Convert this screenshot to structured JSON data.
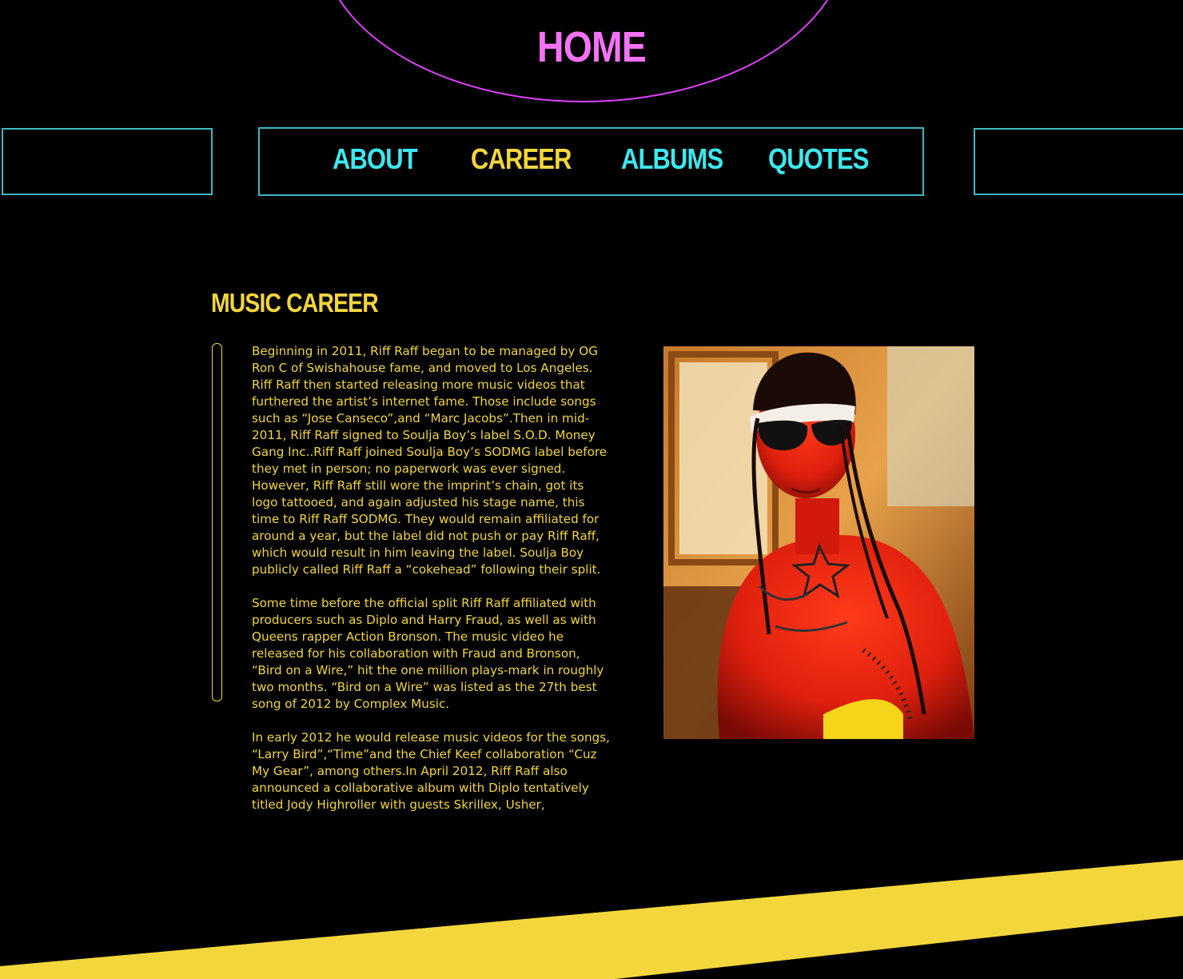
{
  "header": {
    "home_label": "HOME"
  },
  "nav": {
    "items": [
      {
        "label": "ABOUT",
        "color": "#3de8ef"
      },
      {
        "label": "CAREER",
        "color": "#f3d63b"
      },
      {
        "label": "ALBUMS",
        "color": "#3de8ef"
      },
      {
        "label": "QUOTES",
        "color": "#3de8ef"
      }
    ]
  },
  "main": {
    "title": "MUSIC CAREER",
    "paragraphs": [
      "Beginning in 2011, Riff Raff began to be managed by OG Ron C of Swishahouse fame, and moved to Los Angeles. Riff Raff then started releasing more music videos that furthered the artist’s internet fame. Those include songs such as “Jose Canseco”,and “Marc Jacobs”.Then in mid-2011, Riff Raff signed to Soulja Boy’s label S.O.D. Money Gang Inc..Riff Raff joined Soulja Boy’s SODMG label before they met in person; no paperwork was ever signed. However, Riff Raff still wore the imprint’s chain, got its logo tattooed, and again adjusted his stage name, this time to Riff Raff SODMG. They would remain affiliated for around a year, but the label did not push or pay Riff Raff, which would result in him leaving the label. Soulja Boy publicly called Riff Raff a “cokehead” following their split.",
      "Some time before the official split Riff Raff affiliated with producers such as Diplo and Harry Fraud, as well as with Queens rapper Action Bronson. The music video he released for his collaboration with Fraud and Bronson, “Bird on a Wire,” hit the one million plays-mark in roughly two months. “Bird on a Wire” was listed as the 27th best song of 2012 by Complex Music.",
      "In early 2012 he would release music videos for the songs, “Larry Bird”,“Time”and the Chief Keef collaboration “Cuz My Gear”, among others.In April 2012, Riff Raff also announced a collaborative album with Diplo tentatively titled Jody Highroller with guests Skrillex, Usher,"
    ]
  },
  "colors": {
    "background": "#000000",
    "home_accent": "#f472f5",
    "arc": "#e040ff",
    "cyan": "#3de8ef",
    "box_border": "#3fb8c4",
    "yellow": "#f3d63b"
  }
}
